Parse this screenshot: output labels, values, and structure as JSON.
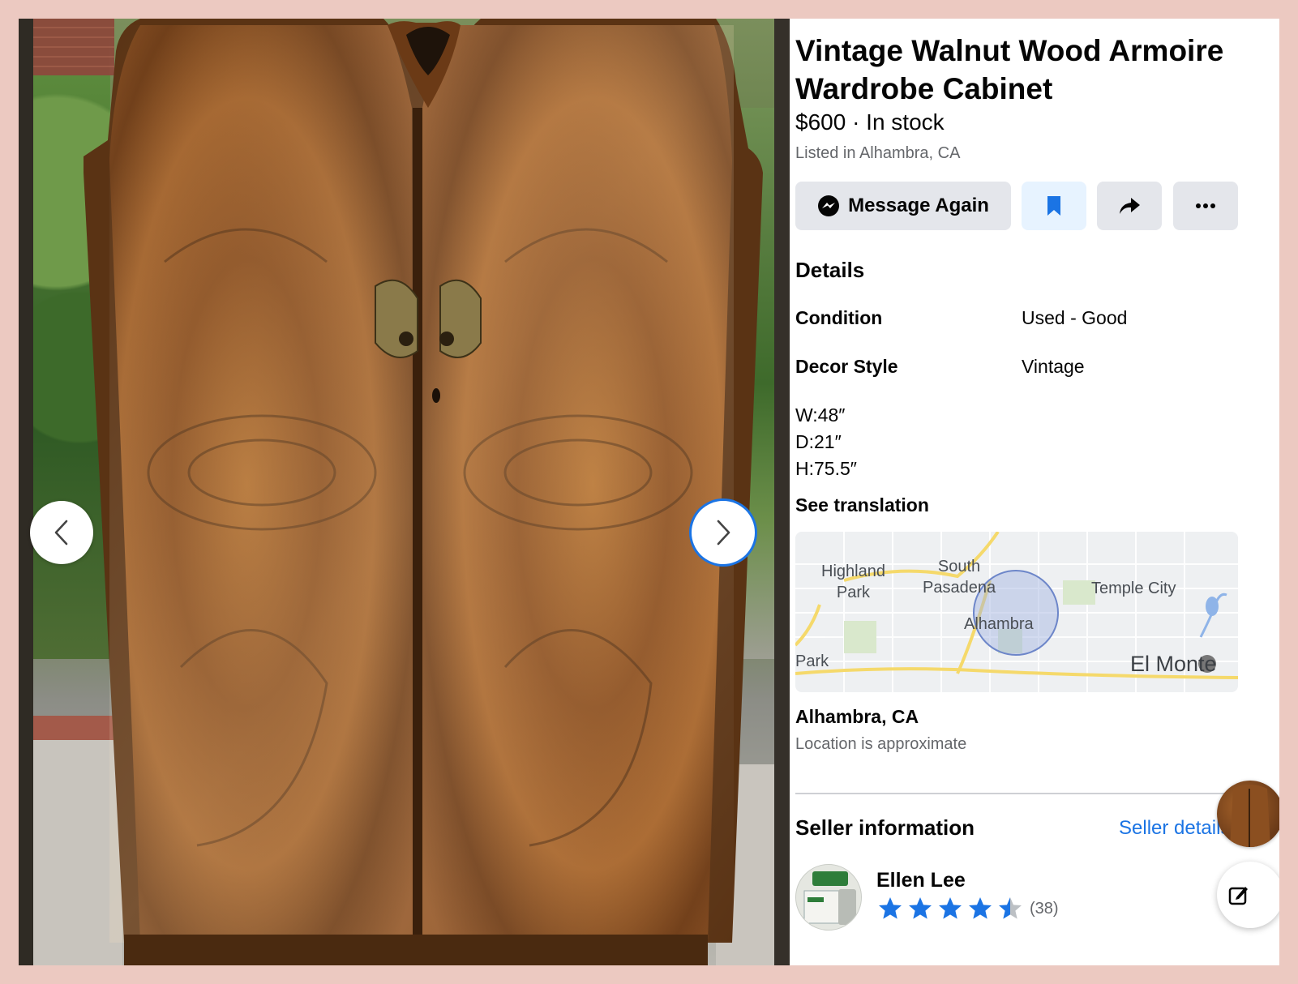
{
  "listing": {
    "title": "Vintage Walnut Wood Armoire Wardrobe Cabinet",
    "price_line": "$600 · In stock",
    "listed_in": "Listed in Alhambra, CA"
  },
  "actions": {
    "message_label": "Message Again"
  },
  "details": {
    "heading": "Details",
    "rows": [
      {
        "label": "Condition",
        "value": "Used - Good"
      },
      {
        "label": "Decor Style",
        "value": "Vintage"
      }
    ],
    "description_lines": [
      "W:48″",
      "D:21″",
      "H:75.5″"
    ],
    "see_translation": "See translation"
  },
  "map": {
    "labels": {
      "highland_park": "Highland\nPark",
      "south_pasadena": "South\nPasadena",
      "temple_city": "Temple City",
      "alhambra": "Alhambra",
      "park": "Park",
      "el_monte": "El Monte"
    }
  },
  "location": {
    "city": "Alhambra, CA",
    "note": "Location is approximate"
  },
  "seller": {
    "heading": "Seller information",
    "details_link": "Seller details",
    "name": "Ellen Lee",
    "rating": 4.5,
    "rating_count": "(38)"
  },
  "icons": {
    "prev": "chevron-left-icon",
    "next": "chevron-right-icon",
    "messenger": "messenger-icon",
    "save": "bookmark-icon",
    "share": "share-arrow-icon",
    "more": "more-dots-icon",
    "compose": "compose-icon"
  },
  "colors": {
    "accent": "#1b74e4",
    "button_bg": "#e4e6eb",
    "save_bg": "#e7f3ff",
    "page_border": "#ecc9c1"
  }
}
